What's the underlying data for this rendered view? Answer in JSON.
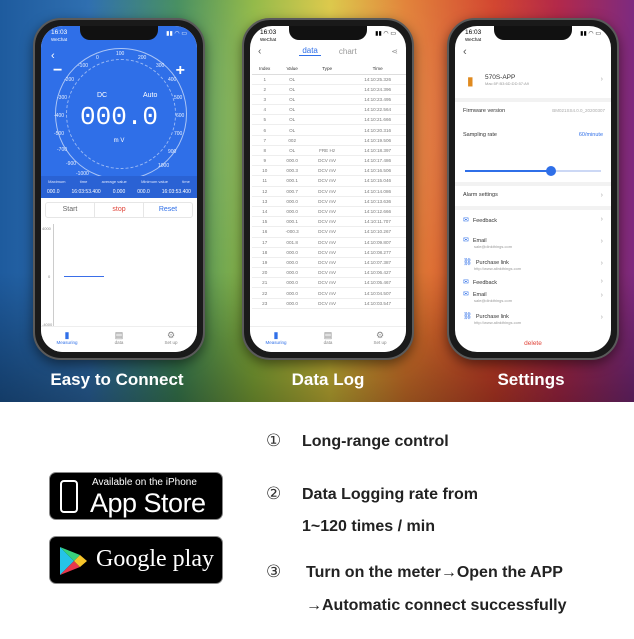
{
  "captions": {
    "connect": "Easy to Connect",
    "datalog": "Data Log",
    "settings": "Settings"
  },
  "status": {
    "time": "16:03",
    "app": "WeChat"
  },
  "meter": {
    "mode_left": "DC",
    "mode_right": "Auto",
    "reading": "000.0",
    "unit": "m V",
    "scale_ticks": [
      "-100",
      "0",
      "100",
      "200",
      "300",
      "400",
      "500",
      "600",
      "700",
      "800",
      "-200",
      "-300",
      "-400",
      "-500",
      "-600",
      "-700",
      "-800",
      "-900",
      "900",
      "1000",
      "-1000"
    ],
    "stats_headers": [
      "Maximum",
      "time",
      "average value",
      "Minimum value",
      "time"
    ],
    "stats_values": [
      "000.0",
      "16:03:53.400",
      "0.000",
      "000.0",
      "16:03:53.400"
    ],
    "controls": {
      "start": "Start",
      "stop": "stop",
      "reset": "Reset"
    },
    "graph_labels": [
      "4000",
      "0",
      "-4000"
    ],
    "graph_xlabel": "time/s"
  },
  "tabs": [
    {
      "label": "Measuring",
      "icon": "ruler-icon"
    },
    {
      "label": "data",
      "icon": "list-icon"
    },
    {
      "label": "Set up",
      "icon": "gear-icon"
    }
  ],
  "datalog": {
    "tab_active": "data",
    "tab_inactive": "chart",
    "headers": [
      "Index",
      "Value",
      "Type",
      "Time"
    ],
    "rows": [
      [
        "1",
        "OL",
        "",
        "14:10:25.326"
      ],
      [
        "2",
        "OL",
        "",
        "14:10:24.396"
      ],
      [
        "3",
        "OL",
        "",
        "14:10:23.495"
      ],
      [
        "4",
        "OL",
        "",
        "14:10:22.564"
      ],
      [
        "5",
        "OL",
        "",
        "14:10:21.666"
      ],
      [
        "6",
        "OL",
        "",
        "14:10:20.316"
      ],
      [
        "7",
        "002",
        "",
        "14:10:19.506"
      ],
      [
        "8",
        "OL",
        "FRE Hz",
        "14:10:18.397"
      ],
      [
        "9",
        "000.0",
        "DCV mV",
        "14:10:17.486"
      ],
      [
        "10",
        "000.3",
        "DCV mV",
        "14:10:16.506"
      ],
      [
        "11",
        "000.1",
        "DCV mV",
        "14:10:15.046"
      ],
      [
        "12",
        "000.7",
        "DCV mV",
        "14:10:14.086"
      ],
      [
        "13",
        "000.0",
        "DCV mV",
        "14:10:13.636"
      ],
      [
        "14",
        "000.0",
        "DCV mV",
        "14:10:12.666"
      ],
      [
        "15",
        "000.1",
        "DCV mV",
        "14:10:11.707"
      ],
      [
        "16",
        "-000.3",
        "DCV mV",
        "14:10:10.267"
      ],
      [
        "17",
        "001.8",
        "DCV mV",
        "14:10:09.807"
      ],
      [
        "18",
        "000.0",
        "DCV mV",
        "14:10:08.277"
      ],
      [
        "19",
        "000.0",
        "DCV mV",
        "14:10:07.387"
      ],
      [
        "20",
        "000.0",
        "DCV mV",
        "14:10:06.427"
      ],
      [
        "21",
        "000.0",
        "DCV mV",
        "14:10:05.467"
      ],
      [
        "22",
        "000.0",
        "DCV mV",
        "14:10:04.507"
      ],
      [
        "23",
        "000.0",
        "DCV mV",
        "14:10:03.547"
      ]
    ]
  },
  "settings": {
    "device_name": "570S-APP",
    "device_mac": "Mac:5F:B3:6D:DD:57:A9",
    "firmware_label": "Firmware version",
    "firmware_value": "BM021SS4.0.0_20200307",
    "rate_label": "Sampling rate",
    "rate_value": "60/minute",
    "alarm": "Alarm settings",
    "feedback": "Feedback",
    "email_label": "Email",
    "email_value": "sale@dinkthings.com",
    "purchase_label": "Purchase link",
    "purchase_value": "http://www.alinkthings.com",
    "delete": "delete"
  },
  "stores": {
    "apple_small": "Available on the iPhone",
    "apple_big": "App Store",
    "google": "Google play"
  },
  "features": [
    {
      "num": "①",
      "lines": [
        "Long-range control"
      ]
    },
    {
      "num": "②",
      "lines": [
        "Data Logging rate from",
        "1~120 times / min"
      ]
    },
    {
      "num": "③",
      "lines": [
        "Turn on the meter→Open the APP",
        "→Automatic connect successfully"
      ]
    }
  ],
  "colors": {
    "accent": "#2f6fe8",
    "stop": "#e0453a"
  }
}
